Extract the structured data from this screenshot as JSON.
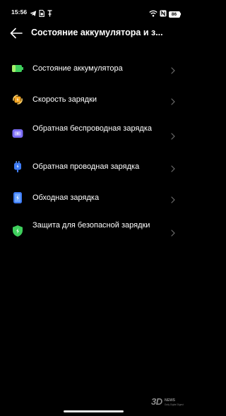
{
  "status_bar": {
    "time": "15:56",
    "left_icons": [
      "telegram-icon",
      "sim-card-icon",
      "pin-icon"
    ],
    "right_icons": [
      "wifi-icon",
      "nfc-icon",
      "battery-icon"
    ],
    "battery_level": "86"
  },
  "header": {
    "title": "Состояние аккумулятора и з..."
  },
  "settings": {
    "items": [
      {
        "label": "Состояние аккумулятора",
        "icon": "battery-health-icon",
        "color": "#3ecf5c"
      },
      {
        "label": "Скорость зарядки",
        "icon": "charging-speed-icon",
        "color": "#f5a623"
      },
      {
        "label": "Обратная беспроводная зарядка",
        "icon": "reverse-wireless-charging-icon",
        "color": "#7b6cf6"
      },
      {
        "label": "Обратная проводная зарядка",
        "icon": "reverse-wired-charging-icon",
        "color": "#3d7bf5"
      },
      {
        "label": "Обходная зарядка",
        "icon": "bypass-charging-icon",
        "color": "#3d7bf5"
      },
      {
        "label": "Защита для безопасной зарядки",
        "icon": "safe-charging-shield-icon",
        "color": "#3ecf5c"
      }
    ]
  },
  "watermark": {
    "big": "3D",
    "small": "NEWS",
    "sub": "Daily Digital Digest"
  }
}
